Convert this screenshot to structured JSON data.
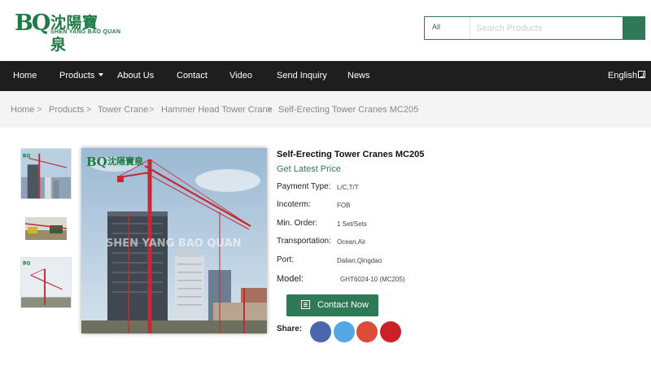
{
  "brand": {
    "logo_mark": "BQ",
    "logo_cn": "沈陽寶泉",
    "logo_en": "SHEN YANG BAO QUAN"
  },
  "search": {
    "category": "All",
    "placeholder": "Search Products",
    "button_icon": "search-icon"
  },
  "nav": {
    "items": [
      "Home",
      "Products",
      "About Us",
      "Contact",
      "Video",
      "Send Inquiry",
      "News"
    ],
    "language": "English"
  },
  "breadcrumb": [
    "Home",
    "Products",
    "Tower Crane",
    "Hammer Head Tower Crane",
    "Self-Erecting Tower Cranes MC205"
  ],
  "product": {
    "title": "Self-Erecting Tower Cranes MC205",
    "latest_price": "Get Latest Price",
    "specs": [
      {
        "label": "Payment Type:",
        "value": "L/C,T/T"
      },
      {
        "label": "Incoterm:",
        "value": "FOB"
      },
      {
        "label": "Min. Order:",
        "value": "1 Set/Sets"
      },
      {
        "label": "Transportation:",
        "value": "Ocean,Air"
      },
      {
        "label": "Port:",
        "value": "Dalian,Qingdao"
      },
      {
        "label": "Model:",
        "value": "GHT6024-10 (MC205)"
      }
    ],
    "contact_label": "Contact Now",
    "share_label": "Share:",
    "image_watermark": "SHEN YANG BAO QUAN"
  },
  "social": [
    {
      "name": "facebook",
      "color": "#4a67ad"
    },
    {
      "name": "twitter",
      "color": "#55a7e4"
    },
    {
      "name": "google-plus",
      "color": "#dd4b39"
    },
    {
      "name": "pinterest",
      "color": "#cb2027"
    }
  ],
  "colors": {
    "brand_green": "#2f7a56",
    "nav_bg": "#1e1e1e",
    "crane_red": "#c42a32"
  }
}
